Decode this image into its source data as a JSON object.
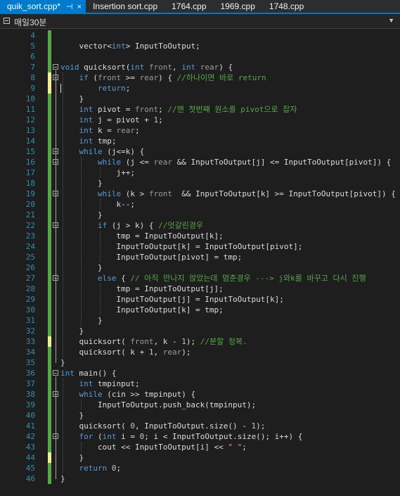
{
  "tabs": [
    {
      "label": "quik_sort.cpp*",
      "active": true
    },
    {
      "label": "Insertion sort.cpp",
      "active": false
    },
    {
      "label": "1764.cpp",
      "active": false
    },
    {
      "label": "1969.cpp",
      "active": false
    },
    {
      "label": "1748.cpp",
      "active": false
    }
  ],
  "tab_icons": {
    "pin": "⊣",
    "close": "×"
  },
  "scope": {
    "label": "매일30분",
    "dropdown_icon": "▼"
  },
  "colors": {
    "accent": "#007acc",
    "keyword": "#569cd6",
    "comment": "#57a64a",
    "line_number": "#2b91af",
    "change_saved": "#57a64a",
    "change_unsaved": "#efef91"
  },
  "editor": {
    "lines": [
      {
        "n": "4",
        "t": "",
        "m": "g"
      },
      {
        "n": "5",
        "t": "    vector<int> InputToOutput;",
        "m": "g"
      },
      {
        "n": "6",
        "t": "",
        "m": "g"
      },
      {
        "n": "7",
        "t": "void quicksort(int front, int rear) {",
        "m": "g",
        "f": 1
      },
      {
        "n": "8",
        "t": "    if (front >= rear) { //하나이면 바로 return",
        "m": "y",
        "f": 1
      },
      {
        "n": "9",
        "t": "        return;",
        "m": "y"
      },
      {
        "n": "10",
        "t": "    }",
        "m": "g"
      },
      {
        "n": "11",
        "t": "    int pivot = front; //맨 첫번째 원소를 pivot으로 잡자",
        "m": "g"
      },
      {
        "n": "12",
        "t": "    int j = pivot + 1;",
        "m": "g"
      },
      {
        "n": "13",
        "t": "    int k = rear;",
        "m": "g"
      },
      {
        "n": "14",
        "t": "    int tmp;",
        "m": "g"
      },
      {
        "n": "15",
        "t": "    while (j<=k) {",
        "m": "g",
        "f": 1
      },
      {
        "n": "16",
        "t": "        while (j <= rear && InputToOutput[j] <= InputToOutput[pivot]) {",
        "m": "g",
        "f": 1
      },
      {
        "n": "17",
        "t": "            j++;",
        "m": "g"
      },
      {
        "n": "18",
        "t": "        }",
        "m": "g"
      },
      {
        "n": "19",
        "t": "        while (k > front  && InputToOutput[k] >= InputToOutput[pivot]) {",
        "m": "g",
        "f": 1
      },
      {
        "n": "20",
        "t": "            k--;",
        "m": "g"
      },
      {
        "n": "21",
        "t": "        }",
        "m": "g"
      },
      {
        "n": "22",
        "t": "        if (j > k) { //엇갈린경우",
        "m": "g",
        "f": 1
      },
      {
        "n": "23",
        "t": "            tmp = InputToOutput[k];",
        "m": "g"
      },
      {
        "n": "24",
        "t": "            InputToOutput[k] = InputToOutput[pivot];",
        "m": "g"
      },
      {
        "n": "25",
        "t": "            InputToOutput[pivot] = tmp;",
        "m": "g"
      },
      {
        "n": "26",
        "t": "        }",
        "m": "g"
      },
      {
        "n": "27",
        "t": "        else { // 아직 만나지 않았는데 멈춘경우 ---> j와k를 바꾸고 다시 진행",
        "m": "g",
        "f": 1
      },
      {
        "n": "28",
        "t": "            tmp = InputToOutput[j];",
        "m": "g"
      },
      {
        "n": "29",
        "t": "            InputToOutput[j] = InputToOutput[k];",
        "m": "g"
      },
      {
        "n": "30",
        "t": "            InputToOutput[k] = tmp;",
        "m": "g"
      },
      {
        "n": "31",
        "t": "        }",
        "m": "g"
      },
      {
        "n": "32",
        "t": "    }",
        "m": "g"
      },
      {
        "n": "33",
        "t": "    quicksort( front, k - 1); //분할 정복.",
        "m": "y"
      },
      {
        "n": "34",
        "t": "    quicksort( k + 1, rear);",
        "m": "g"
      },
      {
        "n": "35",
        "t": "}",
        "m": "g"
      },
      {
        "n": "36",
        "t": "int main() {",
        "m": "g",
        "f": 1
      },
      {
        "n": "37",
        "t": "    int tmpinput;",
        "m": "g"
      },
      {
        "n": "38",
        "t": "    while (cin >> tmpinput) {",
        "m": "g",
        "f": 1
      },
      {
        "n": "39",
        "t": "        InputToOutput.push_back(tmpinput);",
        "m": "g"
      },
      {
        "n": "40",
        "t": "    }",
        "m": "g"
      },
      {
        "n": "41",
        "t": "    quicksort( 0, InputToOutput.size() - 1);",
        "m": "g"
      },
      {
        "n": "42",
        "t": "    for (int i = 0; i < InputToOutput.size(); i++) {",
        "m": "g",
        "f": 1
      },
      {
        "n": "43",
        "t": "        cout << InputToOutput[i] << \" \";",
        "m": "g"
      },
      {
        "n": "44",
        "t": "    }",
        "m": "y"
      },
      {
        "n": "45",
        "t": "    return 0;",
        "m": "g"
      },
      {
        "n": "46",
        "t": "}",
        "m": "g"
      }
    ]
  }
}
